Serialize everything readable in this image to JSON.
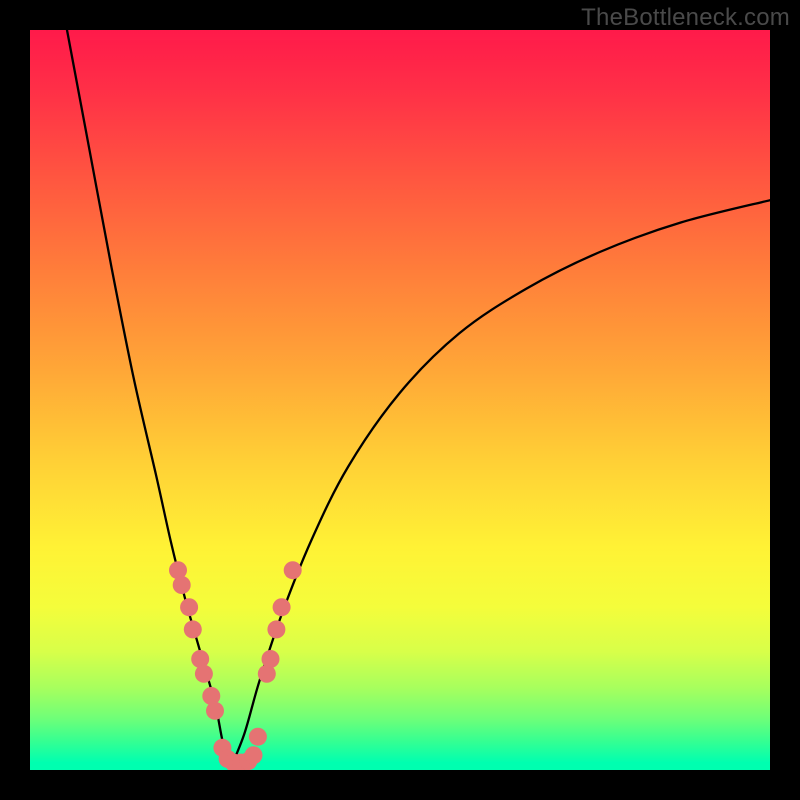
{
  "watermark": "TheBottleneck.com",
  "colors": {
    "frame": "#000000",
    "gradient_top": "#ff1a4a",
    "gradient_mid": "#ffd23a",
    "gradient_bottom": "#00ffb0",
    "curve": "#000000",
    "dots": "#e57373"
  },
  "chart_data": {
    "type": "line",
    "title": "",
    "xlabel": "",
    "ylabel": "",
    "xlim": [
      0,
      100
    ],
    "ylim": [
      0,
      100
    ],
    "grid": false,
    "note": "Axes are not labeled in the image; x and y are normalized 0–100. y=0 at the bottom (green), y=100 at the top (red). The chart depicts a bottleneck-style V curve: left branch descends steeply to a minimum near x≈27, right branch rises and flattens toward the right edge.",
    "series": [
      {
        "name": "left-branch",
        "x": [
          5,
          8,
          11,
          14,
          17,
          19,
          21,
          23,
          25,
          26,
          27
        ],
        "y": [
          100,
          84,
          68,
          53,
          40,
          31,
          23,
          16,
          9,
          4,
          0
        ]
      },
      {
        "name": "right-branch",
        "x": [
          27,
          29,
          31,
          34,
          38,
          43,
          50,
          58,
          67,
          77,
          88,
          100
        ],
        "y": [
          0,
          5,
          12,
          21,
          31,
          41,
          51,
          59,
          65,
          70,
          74,
          77
        ]
      }
    ],
    "dots": {
      "name": "highlighted-points",
      "note": "Salmon dots clustered along both branches in the lower ~30% of the plot, plus a short horizontal run at the valley.",
      "points": [
        {
          "x": 20,
          "y": 27
        },
        {
          "x": 20.5,
          "y": 25
        },
        {
          "x": 21.5,
          "y": 22
        },
        {
          "x": 22,
          "y": 19
        },
        {
          "x": 23,
          "y": 15
        },
        {
          "x": 23.5,
          "y": 13
        },
        {
          "x": 24.5,
          "y": 10
        },
        {
          "x": 25,
          "y": 8
        },
        {
          "x": 26,
          "y": 3
        },
        {
          "x": 26.7,
          "y": 1.5
        },
        {
          "x": 27.5,
          "y": 1
        },
        {
          "x": 28.5,
          "y": 1
        },
        {
          "x": 29.5,
          "y": 1.2
        },
        {
          "x": 30.2,
          "y": 2
        },
        {
          "x": 30.8,
          "y": 4.5
        },
        {
          "x": 32,
          "y": 13
        },
        {
          "x": 32.5,
          "y": 15
        },
        {
          "x": 33.3,
          "y": 19
        },
        {
          "x": 34,
          "y": 22
        },
        {
          "x": 35.5,
          "y": 27
        }
      ]
    }
  }
}
